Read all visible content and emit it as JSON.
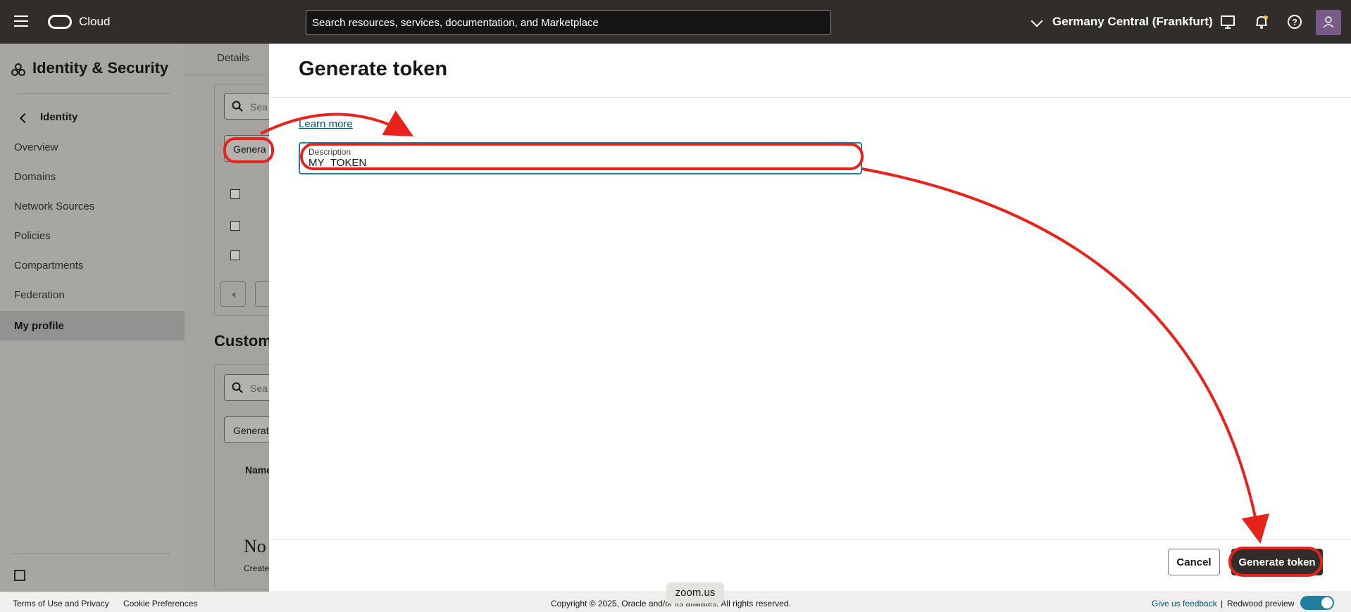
{
  "header": {
    "brand": "Cloud",
    "search_placeholder": "Search resources, services, documentation, and Marketplace",
    "region": "Germany Central (Frankfurt)"
  },
  "sidebar": {
    "title": "Identity & Security",
    "section": "Identity",
    "items": [
      {
        "label": "Overview"
      },
      {
        "label": "Domains"
      },
      {
        "label": "Network Sources"
      },
      {
        "label": "Policies"
      },
      {
        "label": "Compartments"
      },
      {
        "label": "Federation"
      },
      {
        "label": "My profile",
        "active": true
      }
    ]
  },
  "background": {
    "tab": "Details",
    "search_placeholder": "Sea",
    "generate_button": "Genera",
    "section_heading": "Custom",
    "search2_placeholder": "Sea",
    "generate2_button": "Generat",
    "column_header": "Name",
    "empty_title": "No",
    "empty_text": "Create"
  },
  "drawer": {
    "title": "Generate token",
    "learn_more": "Learn more",
    "description_label": "Description",
    "description_value": "MY_TOKEN",
    "cancel_label": "Cancel",
    "submit_label": "Generate token"
  },
  "footer": {
    "terms": "Terms of Use and Privacy",
    "cookies": "Cookie Preferences",
    "copyright": "Copyright © 2025, Oracle and/or its affiliates. All rights reserved.",
    "feedback": "Give us feedback",
    "separator": "|",
    "redwood": "Redwood preview",
    "redwood_enabled": true
  },
  "overlay": {
    "zoom_label": "zoom.us"
  },
  "colors": {
    "topbar": "#312d2a",
    "accent": "#227e9e",
    "annotation": "#e8231c"
  }
}
